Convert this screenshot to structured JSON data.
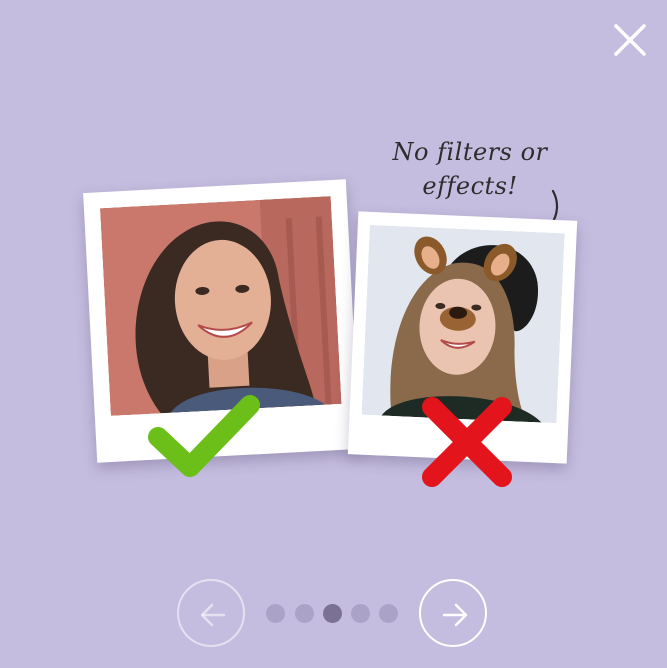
{
  "caption": {
    "line1": "No filters or",
    "line2": "effects!"
  },
  "icons": {
    "close": "close-icon",
    "check": "check-icon",
    "cross": "cross-icon",
    "prev": "arrow-left-icon",
    "next": "arrow-right-icon"
  },
  "photos": [
    {
      "name": "good-example-photo",
      "verdict": "approved"
    },
    {
      "name": "bad-example-photo",
      "verdict": "rejected"
    }
  ],
  "pagination": {
    "total": 5,
    "current": 3
  },
  "colors": {
    "background": "#c5bddf",
    "check": "#6cbf18",
    "cross": "#e3141b",
    "dot": "#aba2c8",
    "dot_active": "#7b7194"
  }
}
